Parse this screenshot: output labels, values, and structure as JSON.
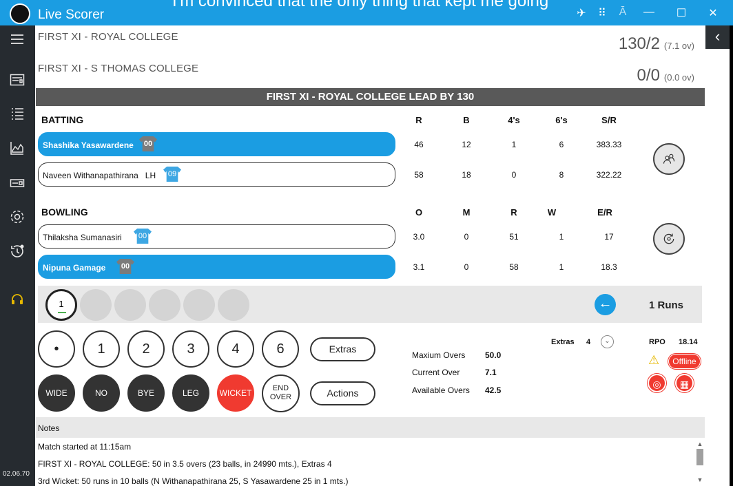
{
  "app": {
    "title": "Live Scorer",
    "version": "02.06.70",
    "overlay_text": "I'm convinced that the only thing that kept me going"
  },
  "titlebar_icons": [
    "airplane-icon",
    "grid-icon",
    "antenna-icon",
    "minimize-icon",
    "maximize-icon",
    "close-icon"
  ],
  "sidebar": {
    "items": [
      {
        "icon": "menu-icon"
      },
      {
        "icon": "scorecard-icon"
      },
      {
        "icon": "list-icon"
      },
      {
        "icon": "chart-icon"
      },
      {
        "icon": "card-icon"
      },
      {
        "icon": "settings-icon"
      },
      {
        "icon": "history-icon"
      },
      {
        "icon": "headset-icon"
      }
    ]
  },
  "teams": [
    {
      "name": "FIRST XI - ROYAL COLLEGE",
      "score": "130/2",
      "overs": "(7.1 ov)"
    },
    {
      "name": "FIRST XI - S THOMAS COLLEGE",
      "score": "0/0",
      "overs": "(0.0 ov)"
    }
  ],
  "lead_text": "FIRST XI - ROYAL COLLEGE LEAD BY 130",
  "batting": {
    "title": "BATTING",
    "columns": [
      "R",
      "B",
      "4's",
      "6's",
      "S/R"
    ],
    "rows": [
      {
        "name": "Shashika Yasawardene",
        "tag": "",
        "shirt": "00",
        "shirt_color": "grey",
        "active": true,
        "values": [
          "46",
          "12",
          "1",
          "6",
          "383.33"
        ]
      },
      {
        "name": "Naveen Withanapathirana",
        "tag": "LH",
        "shirt": "09",
        "shirt_color": "blue",
        "active": false,
        "values": [
          "58",
          "18",
          "0",
          "8",
          "322.22"
        ]
      }
    ]
  },
  "bowling": {
    "title": "BOWLING",
    "columns": [
      "O",
      "M",
      "R",
      "W",
      "E/R"
    ],
    "rows": [
      {
        "name": "Thilaksha Sumanasiri",
        "shirt": "00",
        "shirt_color": "blue",
        "active": false,
        "values": [
          "3.0",
          "0",
          "51",
          "1",
          "17"
        ]
      },
      {
        "name": "Nipuna Gamage",
        "shirt": "00",
        "shirt_color": "grey",
        "active": true,
        "values": [
          "3.1",
          "0",
          "58",
          "1",
          "18.3"
        ]
      }
    ]
  },
  "over_balls": [
    "1",
    "",
    "",
    "",
    "",
    ""
  ],
  "last_runs": "1 Runs",
  "pad": {
    "runs": [
      "•",
      "1",
      "2",
      "3",
      "4",
      "6"
    ],
    "extras_label": "Extras",
    "actions_label": "Actions",
    "wide": "WIDE",
    "no_ball": "NO BALL",
    "bye": "BYE",
    "leg_bye": "LEG BYE",
    "wicket": "WICKET",
    "end_over": "END OVER"
  },
  "info": {
    "max_overs_label": "Maxium Overs",
    "max_overs": "50.0",
    "current_over_label": "Current Over",
    "current_over": "7.1",
    "available_overs_label": "Available Overs",
    "available_overs": "42.5",
    "extras_label": "Extras",
    "extras": "4",
    "rpo_label": "RPO",
    "rpo": "18.14",
    "status": "Offline"
  },
  "notes": {
    "title": "Notes",
    "lines": [
      "Match started at 11:15am",
      "FIRST XI - ROYAL COLLEGE: 50 in 3.5 overs (23 balls, in 24990 mts.), Extras 4",
      "3rd Wicket: 50 runs in 10 balls (N Withanapathirana 25, S Yasawardene 25 in 1 mts.)"
    ]
  }
}
